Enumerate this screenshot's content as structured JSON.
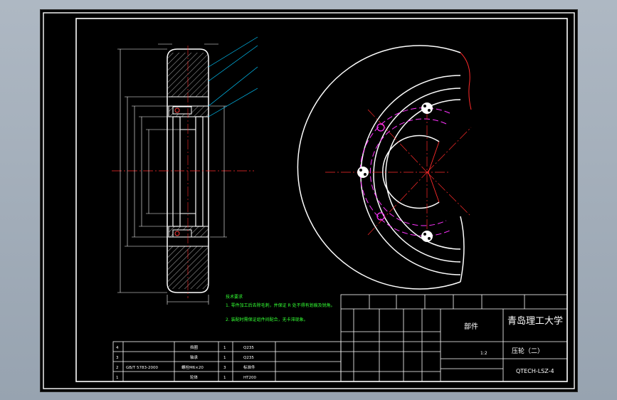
{
  "notes": {
    "heading": "技术要求",
    "line1": "1. 零件加工后去除毛刺，并保证 R 处不得有划痕及锐角。",
    "line2": "2. 装配时需保证组件间配合，无卡滞现象。"
  },
  "title_block": {
    "university": "青岛理工大学",
    "part_kind": "部件",
    "part_name": "压轮（二）",
    "drawing_no": "QTECH-LSZ-4",
    "ratio": "1:2"
  },
  "bom": [
    {
      "no": "4",
      "code": "",
      "name": "挡圈",
      "qty": "1",
      "material": "Q235"
    },
    {
      "no": "3",
      "code": "",
      "name": "轴承",
      "qty": "1",
      "material": "Q235"
    },
    {
      "no": "2",
      "code": "GB/T 5783-2000",
      "name": "螺栓M6×20",
      "qty": "3",
      "material": "标准件"
    },
    {
      "no": "1",
      "code": "",
      "name": "轮体",
      "qty": "1",
      "material": "HT200"
    }
  ],
  "colors": {
    "frame": "#ffffff",
    "leader": "#00c8ff",
    "center_line": "#ff2a2a",
    "hidden_line": "#ff33ff",
    "note_text": "#33ff33",
    "hatch": "#ffffff"
  }
}
